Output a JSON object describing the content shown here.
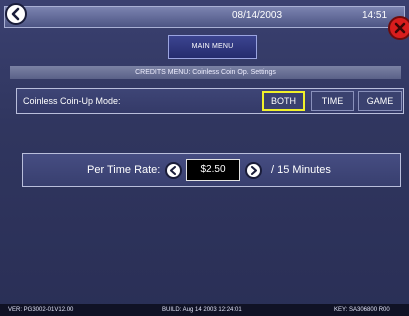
{
  "header": {
    "date": "08/14/2003",
    "time": "14:51",
    "main_menu_label": "MAIN MENU"
  },
  "breadcrumb": "CREDITS MENU: Coinless Coin Op. Settings",
  "mode": {
    "label": "Coinless Coin-Up Mode:",
    "options": [
      "BOTH",
      "TIME",
      "GAME"
    ],
    "selected": "BOTH",
    "highlight_color": "#f1f12a"
  },
  "rate": {
    "label": "Per Time Rate:",
    "value": "$2.50",
    "unit": "/ 15 Minutes"
  },
  "footer": {
    "version": "VER: PG3002-01V12.00",
    "build": "BUILD: Aug 14 2003 12:24:01",
    "key": "KEY: SA306800 R00"
  },
  "icons": {
    "back": "back-arrow-icon",
    "close": "close-icon",
    "decrement": "left-arrow-icon",
    "increment": "right-arrow-icon"
  }
}
